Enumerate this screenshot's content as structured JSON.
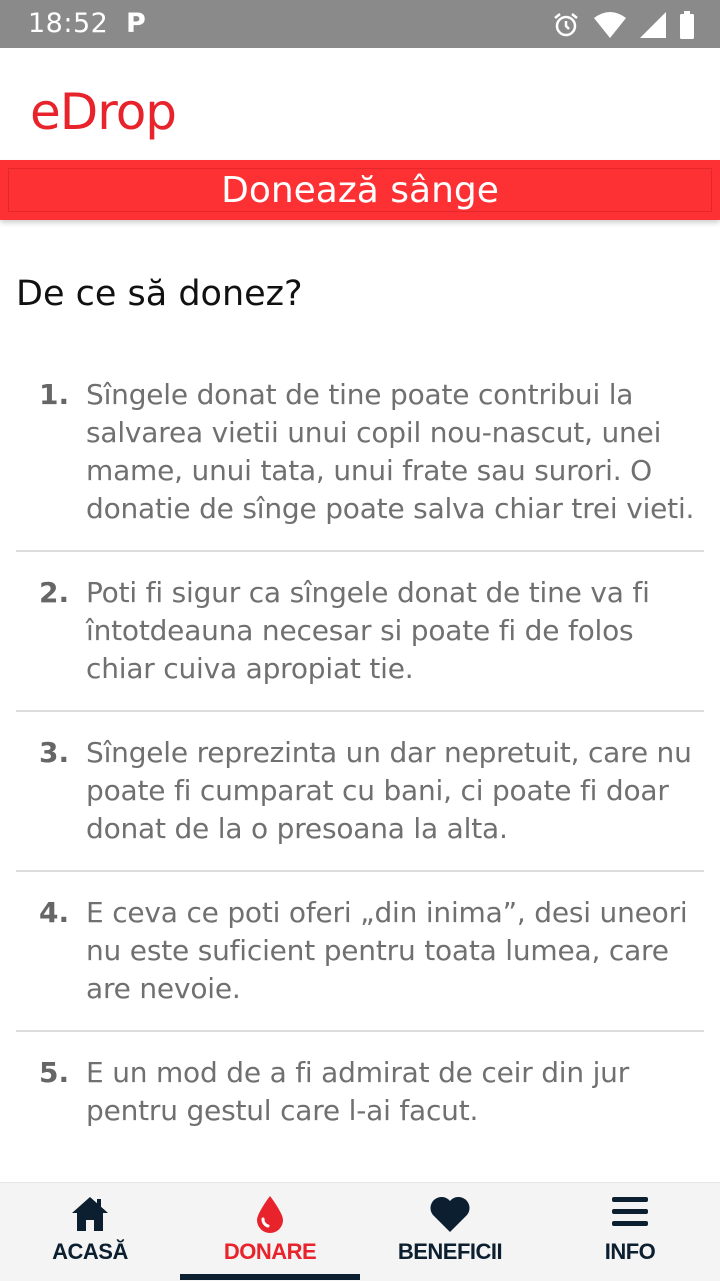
{
  "status_bar": {
    "time": "18:52",
    "notification": "P"
  },
  "header": {
    "logo": "eDrop"
  },
  "page": {
    "title": "Donează sânge",
    "heading": "De ce să donez?"
  },
  "reasons": [
    {
      "num": "1.",
      "text": "Sîngele donat de tine poate contribui la salvarea vietii unui copil nou-nascut, unei mame, unui tata, unui frate sau surori. O donatie de sînge poate salva chiar trei vieti."
    },
    {
      "num": "2.",
      "text": "Poti fi sigur ca sîngele donat de tine va fi întotdeauna necesar si poate fi de folos chiar cuiva apropiat tie."
    },
    {
      "num": "3.",
      "text": "Sîngele reprezinta un dar nepretuit, care nu poate fi cumparat cu bani, ci poate fi doar donat de la o presoana la alta."
    },
    {
      "num": "4.",
      "text": "E ceva ce poti oferi „din inima”, desi uneori nu este suficient pentru toata lumea, care are nevoie."
    },
    {
      "num": "5.",
      "text": "E un mod de a fi admirat de ceir din jur pentru gestul care l-ai facut."
    }
  ],
  "nav": {
    "home": "ACASĂ",
    "donate": "DONARE",
    "benefits": "BENEFICII",
    "info": "INFO"
  },
  "colors": {
    "brand_red": "#e8232b",
    "title_bar": "#fd3034",
    "nav_dark": "#0c1f30"
  }
}
